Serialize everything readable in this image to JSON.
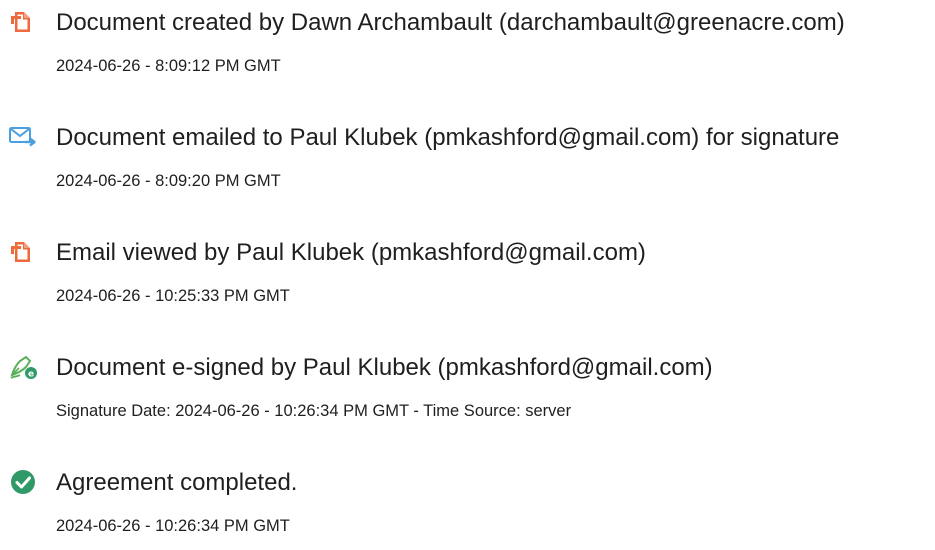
{
  "colors": {
    "doc_icon": "#ec6a3c",
    "email_icon": "#4a9fe0",
    "sign_icon": "#5ab05a",
    "sign_badge": "#2f9a67",
    "check_icon": "#2f9a67",
    "text": "#1f1f1f"
  },
  "events": [
    {
      "icon": "document-icon",
      "title": "Document created by Dawn Archambault (darchambault@greenacre.com)",
      "time": "2024-06-26 - 8:09:12 PM GMT"
    },
    {
      "icon": "email-icon",
      "title": "Document emailed to Paul Klubek (pmkashford@gmail.com) for signature",
      "time": "2024-06-26 - 8:09:20 PM GMT"
    },
    {
      "icon": "document-icon",
      "title": "Email viewed by Paul Klubek (pmkashford@gmail.com)",
      "time": "2024-06-26 - 10:25:33 PM GMT"
    },
    {
      "icon": "esign-icon",
      "title": "Document e-signed by Paul Klubek (pmkashford@gmail.com)",
      "time": "Signature Date: 2024-06-26 - 10:26:34 PM GMT - Time Source: server"
    },
    {
      "icon": "checkmark-icon",
      "title": "Agreement completed.",
      "time": "2024-06-26 - 10:26:34 PM GMT"
    }
  ]
}
